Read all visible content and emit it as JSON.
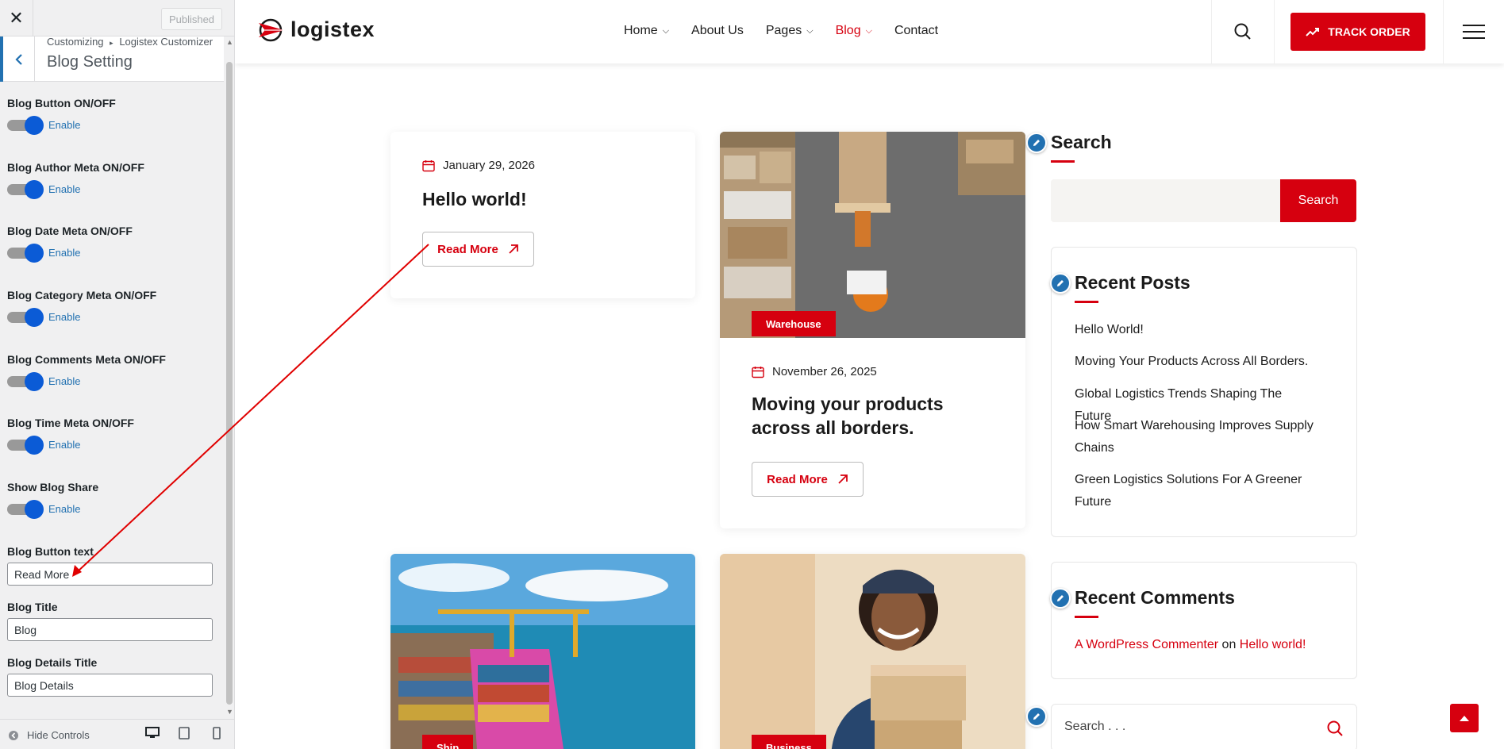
{
  "customizer": {
    "close_icon": "close-icon",
    "published_label": "Published",
    "breadcrumb_root": "Customizing",
    "breadcrumb_sep": "▸",
    "breadcrumb_parent": "Logistex Customizer",
    "section_title": "Blog Setting",
    "toggles": [
      {
        "label": "Blog Button ON/OFF",
        "state": "Enable"
      },
      {
        "label": "Blog Author Meta ON/OFF",
        "state": "Enable"
      },
      {
        "label": "Blog Date Meta ON/OFF",
        "state": "Enable"
      },
      {
        "label": "Blog Category Meta ON/OFF",
        "state": "Enable"
      },
      {
        "label": "Blog Comments Meta ON/OFF",
        "state": "Enable"
      },
      {
        "label": "Blog Time Meta ON/OFF",
        "state": "Enable"
      },
      {
        "label": "Show Blog Share",
        "state": "Enable"
      }
    ],
    "fields": [
      {
        "label": "Blog Button text",
        "value": "Read More"
      },
      {
        "label": "Blog Title",
        "value": "Blog"
      },
      {
        "label": "Blog Details Title",
        "value": "Blog Details"
      }
    ],
    "hide_controls_label": "Hide Controls"
  },
  "site": {
    "logo_text": "logistex",
    "nav": [
      {
        "label": "Home",
        "dropdown": true,
        "active": false
      },
      {
        "label": "About Us",
        "dropdown": false,
        "active": false
      },
      {
        "label": "Pages",
        "dropdown": true,
        "active": false
      },
      {
        "label": "Blog",
        "dropdown": true,
        "active": true
      },
      {
        "label": "Contact",
        "dropdown": false,
        "active": false
      }
    ],
    "track_order_label": "TRACK ORDER",
    "accent_color": "#d6000f"
  },
  "posts": [
    {
      "date": "January 29, 2026",
      "title": "Hello world!",
      "read_more": "Read More"
    },
    {
      "date": "November 26, 2025",
      "title_line1": "Moving your products",
      "title_line2": "across all borders.",
      "badge": "Warehouse",
      "read_more": "Read More"
    },
    {
      "badge": "Ship"
    },
    {
      "badge": "Business"
    }
  ],
  "sidebar": {
    "search_title": "Search",
    "search_button": "Search",
    "recent_posts_title": "Recent Posts",
    "recent_posts": [
      "Hello World!",
      "Moving Your Products Across All Borders.",
      "Global Logistics Trends Shaping The Future",
      "How Smart Warehousing Improves Supply",
      "Chains",
      "Green Logistics Solutions For A Greener",
      "Future"
    ],
    "recent_comments_title": "Recent Comments",
    "comment_author": "A WordPress Commenter",
    "comment_on": "on",
    "comment_post": "Hello world!",
    "search2_placeholder": "Search . . ."
  }
}
